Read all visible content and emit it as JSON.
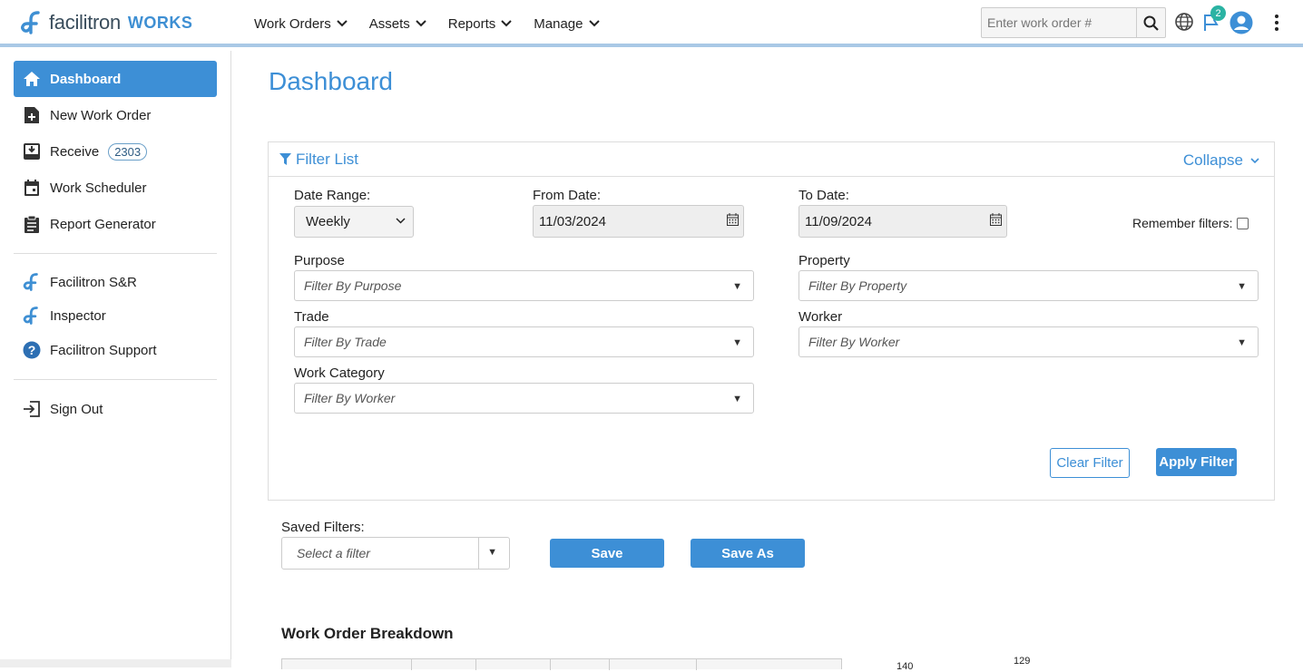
{
  "brand": {
    "name": "facilitron",
    "product": "WORKS"
  },
  "nav": [
    {
      "label": "Work Orders"
    },
    {
      "label": "Assets"
    },
    {
      "label": "Reports"
    },
    {
      "label": "Manage"
    }
  ],
  "search": {
    "placeholder": "Enter work order #",
    "value": ""
  },
  "notifications": {
    "count": "2"
  },
  "sidebar": {
    "items": [
      {
        "label": "Dashboard",
        "icon": "home-icon",
        "active": true
      },
      {
        "label": "New Work Order",
        "icon": "add-document-icon"
      },
      {
        "label": "Receive",
        "icon": "inbox-download-icon",
        "count": "2303"
      },
      {
        "label": "Work Scheduler",
        "icon": "calendar-icon"
      },
      {
        "label": "Report Generator",
        "icon": "clipboard-icon"
      }
    ],
    "links": [
      {
        "label": "Facilitron S&R",
        "icon": "facilitron-logo-icon"
      },
      {
        "label": "Inspector",
        "icon": "facilitron-logo-icon"
      },
      {
        "label": "Facilitron Support",
        "icon": "help-circle-icon"
      }
    ],
    "sign_out": {
      "label": "Sign Out",
      "icon": "sign-out-icon"
    }
  },
  "page": {
    "title": "Dashboard"
  },
  "filter": {
    "title": "Filter List",
    "collapse_label": "Collapse",
    "date_range": {
      "label": "Date Range:",
      "value": "Weekly"
    },
    "from_date": {
      "label": "From Date:",
      "value": "11/03/2024"
    },
    "to_date": {
      "label": "To Date:",
      "value": "11/09/2024"
    },
    "remember_label": "Remember filters:",
    "remember_checked": false,
    "purpose": {
      "label": "Purpose",
      "placeholder": "Filter By Purpose"
    },
    "property": {
      "label": "Property",
      "placeholder": "Filter By Property"
    },
    "trade": {
      "label": "Trade",
      "placeholder": "Filter By Trade"
    },
    "worker": {
      "label": "Worker",
      "placeholder": "Filter By Worker"
    },
    "work_category": {
      "label": "Work Category",
      "placeholder": "Filter By Worker"
    },
    "clear_label": "Clear Filter",
    "apply_label": "Apply Filter"
  },
  "saved_filters": {
    "label": "Saved Filters:",
    "placeholder": "Select a filter",
    "save_label": "Save",
    "save_as_label": "Save As"
  },
  "breakdown": {
    "title": "Work Order Breakdown",
    "chart_tick": "140",
    "chart_value": "129"
  },
  "colors": {
    "accent": "#3d8fd6",
    "badge": "#2bb3a3"
  }
}
